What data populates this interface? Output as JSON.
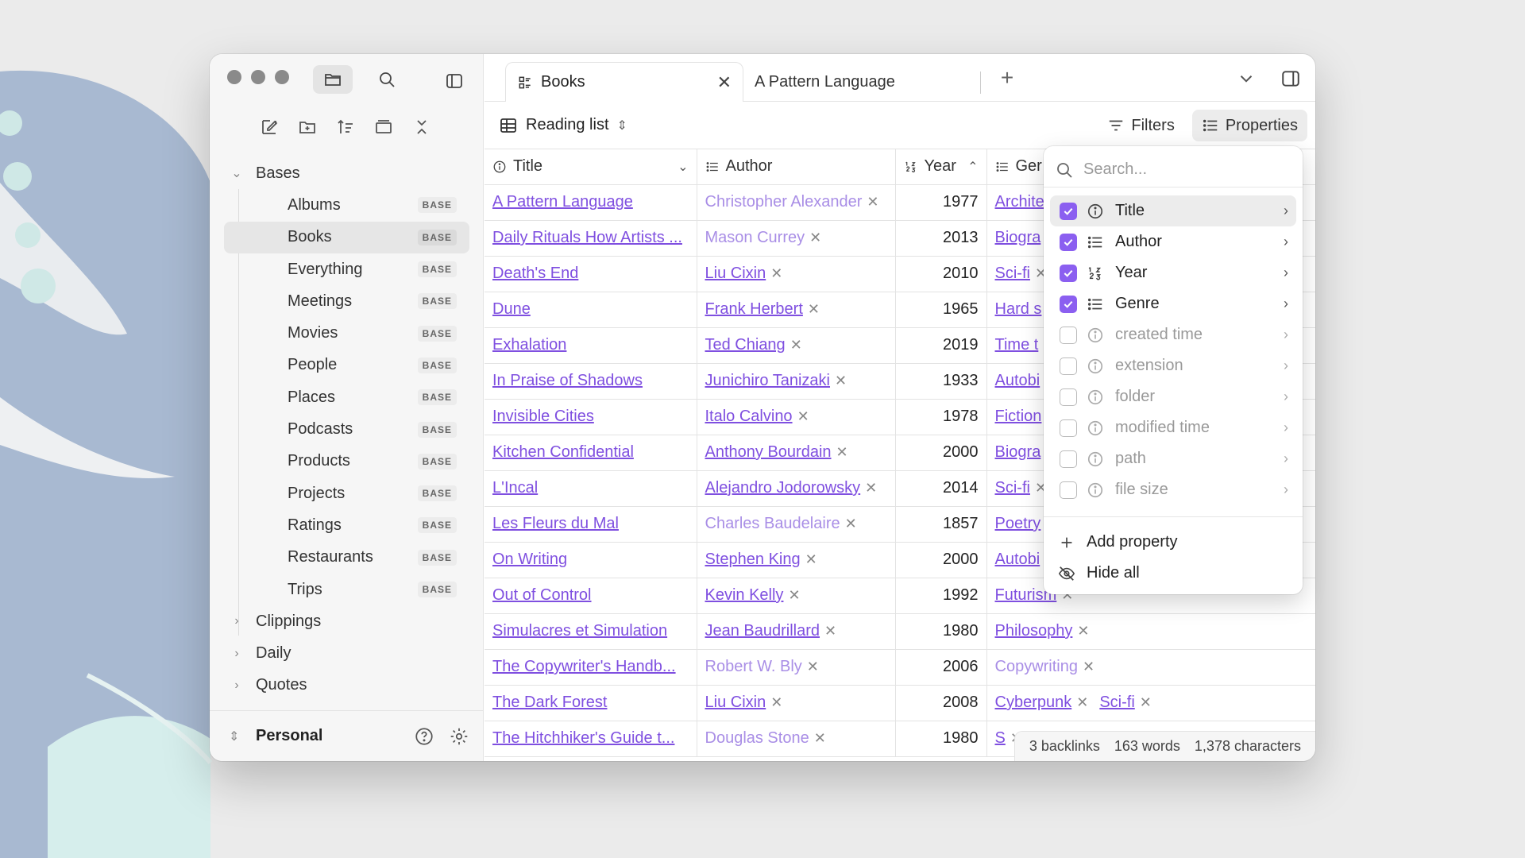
{
  "colors": {
    "accent": "#8b5ff0",
    "link": "#7f4fe0",
    "link_muted": "#a98ee6"
  },
  "sidebar": {
    "tree": [
      {
        "label": "Bases",
        "expanded": true
      },
      {
        "label": "Albums",
        "badge": "BASE"
      },
      {
        "label": "Books",
        "badge": "BASE",
        "selected": true
      },
      {
        "label": "Everything",
        "badge": "BASE"
      },
      {
        "label": "Meetings",
        "badge": "BASE"
      },
      {
        "label": "Movies",
        "badge": "BASE"
      },
      {
        "label": "People",
        "badge": "BASE"
      },
      {
        "label": "Places",
        "badge": "BASE"
      },
      {
        "label": "Podcasts",
        "badge": "BASE"
      },
      {
        "label": "Products",
        "badge": "BASE"
      },
      {
        "label": "Projects",
        "badge": "BASE"
      },
      {
        "label": "Ratings",
        "badge": "BASE"
      },
      {
        "label": "Restaurants",
        "badge": "BASE"
      },
      {
        "label": "Trips",
        "badge": "BASE"
      },
      {
        "label": "Clippings"
      },
      {
        "label": "Daily"
      },
      {
        "label": "Quotes"
      }
    ],
    "vault": "Personal"
  },
  "tabs": [
    {
      "label": "Books",
      "active": true
    },
    {
      "label": "A Pattern Language"
    }
  ],
  "viewbar": {
    "view_name": "Reading list",
    "filters": "Filters",
    "properties": "Properties"
  },
  "table": {
    "headers": [
      "Title",
      "Author",
      "Year",
      "Ger"
    ],
    "rows": [
      [
        "A Pattern Language",
        "Christopher Alexander",
        "1977",
        "Archite"
      ],
      [
        "Daily Rituals How Artists ...",
        "Mason Currey",
        "2013",
        "Biogra"
      ],
      [
        "Death's End",
        "Liu Cixin",
        "2010",
        "Sci-fi"
      ],
      [
        "Dune",
        "Frank Herbert",
        "1965",
        "Hard s"
      ],
      [
        "Exhalation",
        "Ted Chiang",
        "2019",
        "Time t"
      ],
      [
        "In Praise of Shadows",
        "Junichiro Tanizaki",
        "1933",
        "Autobi"
      ],
      [
        "Invisible Cities",
        "Italo Calvino",
        "1978",
        "Fiction"
      ],
      [
        "Kitchen Confidential",
        "Anthony Bourdain",
        "2000",
        "Biogra"
      ],
      [
        "L'Incal",
        "Alejandro Jodorowsky",
        "2014",
        "Sci-fi"
      ],
      [
        "Les Fleurs du Mal",
        "Charles Baudelaire",
        "1857",
        "Poetry"
      ],
      [
        "On Writing",
        "Stephen King",
        "2000",
        "Autobi"
      ],
      [
        "Out of Control",
        "Kevin Kelly",
        "1992",
        "Futurism"
      ],
      [
        "Simulacres et Simulation",
        "Jean Baudrillard",
        "1980",
        "Philosophy"
      ],
      [
        "The Copywriter's Handb...",
        "Robert W. Bly",
        "2006",
        "Copywriting"
      ],
      [
        "The Dark Forest",
        "Liu Cixin",
        "2008",
        "Cyberpunk"
      ],
      [
        "The Hitchhiker's Guide t...",
        "Douglas Stone",
        "1980",
        "S"
      ]
    ],
    "muted_authors": [
      0,
      1,
      9,
      13,
      15
    ],
    "extra_genre_row14": "Sci-fi"
  },
  "popup": {
    "search_placeholder": "Search...",
    "properties": [
      {
        "label": "Title",
        "checked": true,
        "icon": "info-icon"
      },
      {
        "label": "Author",
        "checked": true,
        "icon": "list-icon"
      },
      {
        "label": "Year",
        "checked": true,
        "icon": "number-icon"
      },
      {
        "label": "Genre",
        "checked": true,
        "icon": "list-icon"
      },
      {
        "label": "created time",
        "checked": false,
        "icon": "info-icon"
      },
      {
        "label": "extension",
        "checked": false,
        "icon": "info-icon"
      },
      {
        "label": "folder",
        "checked": false,
        "icon": "info-icon"
      },
      {
        "label": "modified time",
        "checked": false,
        "icon": "info-icon"
      },
      {
        "label": "path",
        "checked": false,
        "icon": "info-icon"
      },
      {
        "label": "file size",
        "checked": false,
        "icon": "info-icon"
      }
    ],
    "add_property": "Add property",
    "hide_all": "Hide all"
  },
  "status": {
    "backlinks": "3 backlinks",
    "words": "163 words",
    "characters": "1,378 characters"
  }
}
